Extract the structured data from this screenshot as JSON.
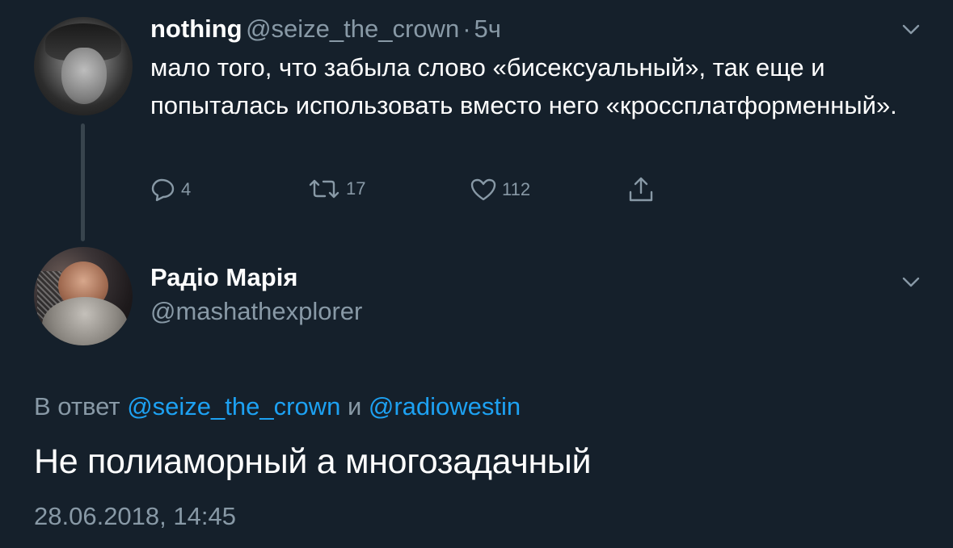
{
  "parent_tweet": {
    "author_name": "nothing",
    "author_handle": "@seize_the_crown",
    "separator": "·",
    "time": "5ч",
    "text": "мало того, что забыла слово «бисексуальный», так еще и попыталась использовать вместо него «кроссплатформенный».",
    "reply_count": "4",
    "retweet_count": "17",
    "like_count": "112",
    "avatar_icon": "avatar-photo-icon"
  },
  "reply_tweet": {
    "author_name": "Радіо Марія",
    "author_handle": "@mashathexplorer",
    "in_reply_prefix": "В ответ",
    "in_reply_mention_1": "@seize_the_crown",
    "in_reply_conjunction": "и",
    "in_reply_mention_2": "@radiowestin",
    "text": "Не полиаморный а многозадачный",
    "timestamp": "28.06.2018, 14:45",
    "avatar_icon": "avatar-photo-icon"
  },
  "icons": {
    "more": "chevron-down-icon",
    "reply": "reply-icon",
    "retweet": "retweet-icon",
    "like": "heart-icon",
    "share": "share-icon"
  },
  "colors": {
    "background": "#15202b",
    "text_primary": "#ffffff",
    "text_secondary": "#8899a6",
    "link": "#1da1f2",
    "thread_line": "#38444d"
  }
}
